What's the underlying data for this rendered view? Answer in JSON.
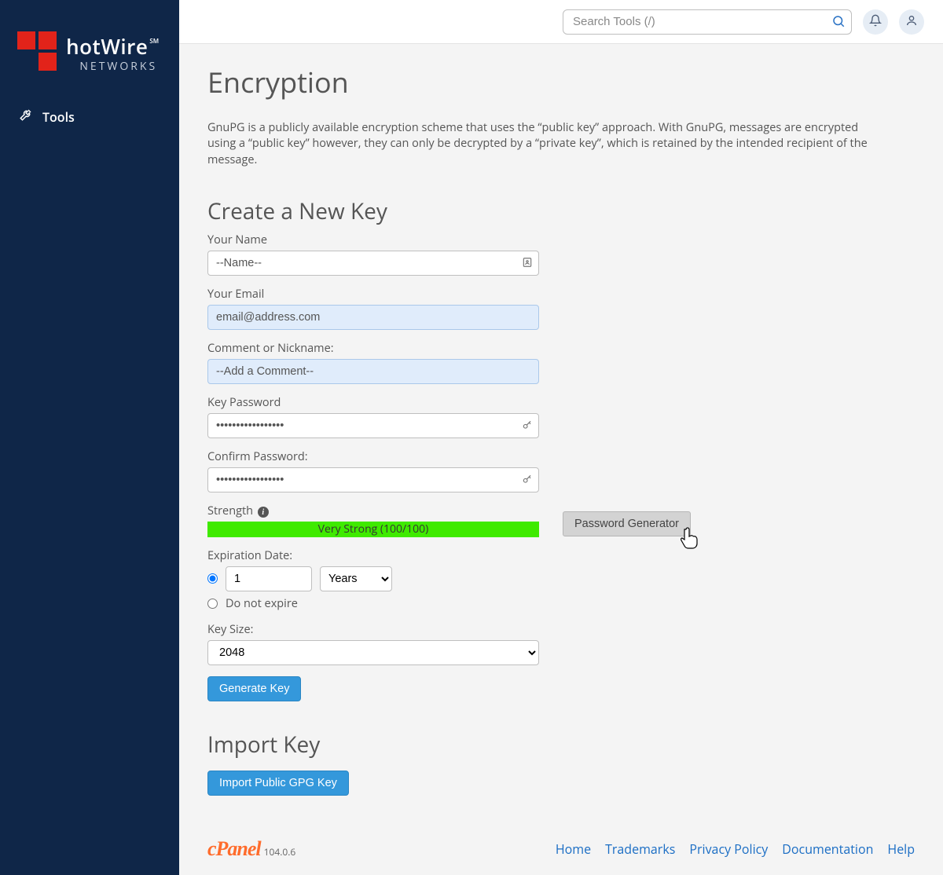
{
  "brand": {
    "name": "hotWire",
    "sm": "SM",
    "tag": "NETWORKS"
  },
  "sidebar": {
    "tools": "Tools"
  },
  "search": {
    "placeholder": "Search Tools (/)"
  },
  "page": {
    "title": "Encryption",
    "description": "GnuPG is a publicly available encryption scheme that uses the “public key” approach. With GnuPG, messages are encrypted using a “public key” however, they can only be decrypted by a “private key”, which is retained by the intended recipient of the message."
  },
  "form": {
    "heading": "Create a New Key",
    "name_label": "Your Name",
    "name_value": "--Name--",
    "email_label": "Your Email",
    "email_value": "email@address.com",
    "comment_label": "Comment or Nickname:",
    "comment_value": "--Add a Comment--",
    "key_password_label": "Key Password",
    "key_password_value": "•••••••••••••••••",
    "confirm_password_label": "Confirm Password:",
    "confirm_password_value": "•••••••••••••••••",
    "strength_label": "Strength",
    "strength_text": "Very Strong (100/100)",
    "password_generator": "Password Generator",
    "expiration_label": "Expiration Date:",
    "expiration_value": "1",
    "expiration_unit": "Years",
    "do_not_expire": "Do not expire",
    "key_size_label": "Key Size:",
    "key_size_value": "2048",
    "generate_btn": "Generate Key"
  },
  "import": {
    "heading": "Import Key",
    "button": "Import Public GPG Key"
  },
  "footer": {
    "product": "cPanel",
    "version": "104.0.6",
    "links": [
      "Home",
      "Trademarks",
      "Privacy Policy",
      "Documentation",
      "Help"
    ]
  }
}
